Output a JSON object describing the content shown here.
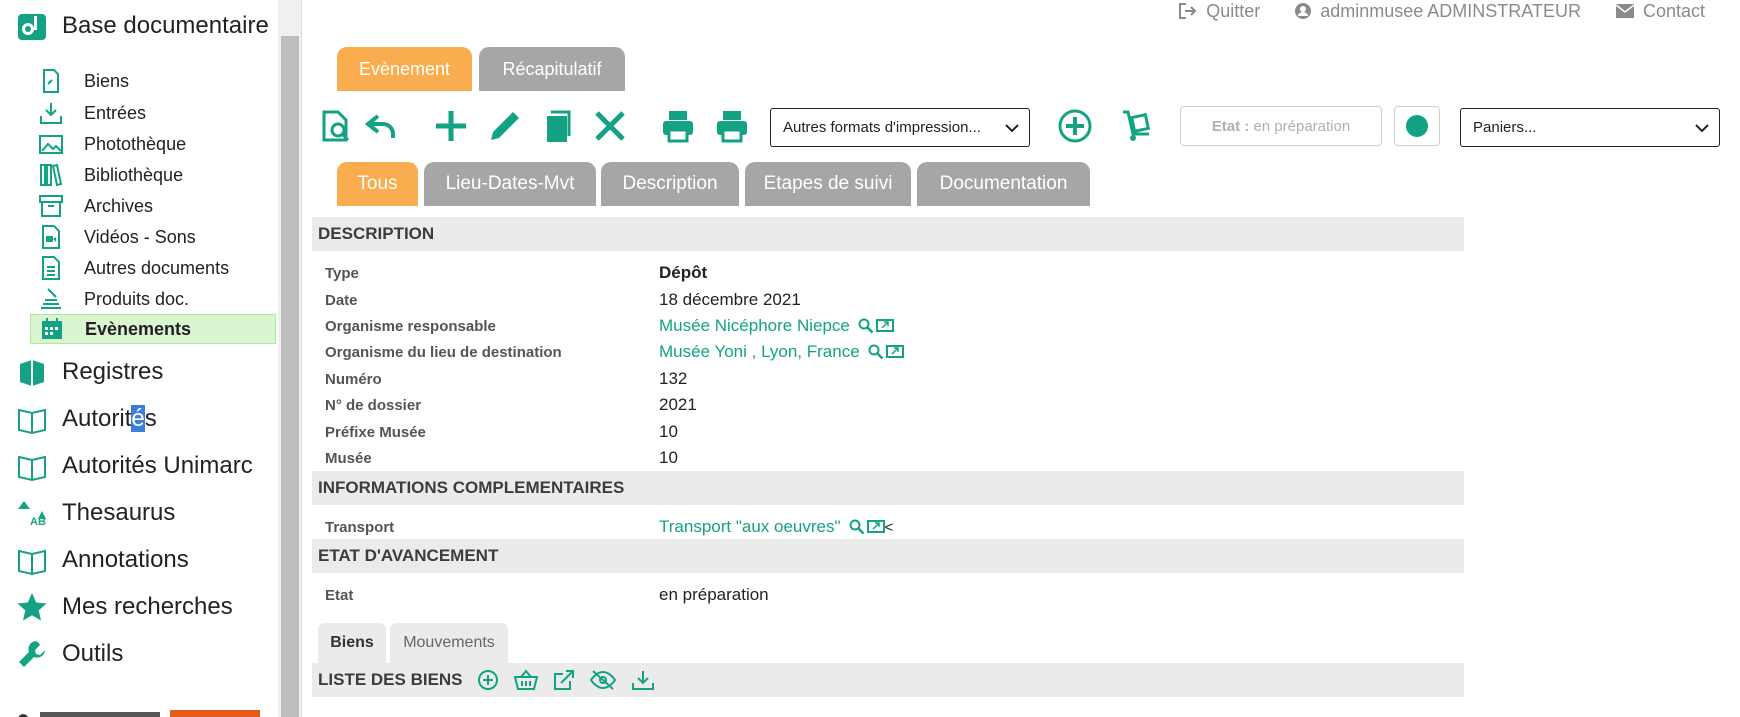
{
  "sidebar": {
    "title": "Base documentaire",
    "sub_items": [
      {
        "label": "Biens"
      },
      {
        "label": "Entrées"
      },
      {
        "label": "Photothèque"
      },
      {
        "label": "Bibliothèque"
      },
      {
        "label": "Archives"
      },
      {
        "label": "Vidéos - Sons"
      },
      {
        "label": "Autres documents"
      },
      {
        "label": "Produits doc."
      },
      {
        "label": "Evènements"
      }
    ],
    "top_items": [
      {
        "label": "Registres"
      },
      {
        "label_pre": "Autorit",
        "label_hl": "é",
        "label_post": "s"
      },
      {
        "label": "Autorités Unimarc"
      },
      {
        "label": "Thesaurus"
      },
      {
        "label": "Annotations"
      },
      {
        "label": "Mes recherches"
      },
      {
        "label": "Outils"
      }
    ]
  },
  "topbar": {
    "quit": "Quitter",
    "user": "adminmusee ADMINSTRATEUR",
    "contact": "Contact"
  },
  "main_tabs": [
    "Evènement",
    "Récapitulatif"
  ],
  "toolbar": {
    "print_select": "Autres formats d'impression...",
    "etat_label": "Etat :",
    "etat_value": "en préparation",
    "panier_select": "Paniers..."
  },
  "section_tabs": [
    "Tous",
    "Lieu-Dates-Mvt",
    "Description",
    "Etapes de suivi",
    "Documentation"
  ],
  "description": {
    "header": "DESCRIPTION",
    "rows": [
      {
        "label": "Type",
        "value": "Dépôt"
      },
      {
        "label": "Date",
        "value": "18 décembre 2021"
      },
      {
        "label": "Organisme responsable",
        "value": "Musée Nicéphore Niepce"
      },
      {
        "label": "Organisme du lieu de destination",
        "value": "Musée Yoni , Lyon, France"
      },
      {
        "label": "Numéro",
        "value": "132"
      },
      {
        "label": "N° de dossier",
        "value": "2021"
      },
      {
        "label": "Préfixe Musée",
        "value": "10"
      },
      {
        "label": "Musée",
        "value": "10"
      }
    ]
  },
  "infos": {
    "header": "INFORMATIONS COMPLEMENTAIRES",
    "rows": [
      {
        "label": "Transport",
        "value": "Transport \"aux oeuvres\"",
        "suffix": "<"
      }
    ]
  },
  "etat": {
    "header": "ETAT D'AVANCEMENT",
    "rows": [
      {
        "label": "Etat",
        "value": "en préparation"
      }
    ]
  },
  "bottom_tabs": [
    "Biens",
    "Mouvements"
  ],
  "liste": {
    "header": "LISTE DES BIENS"
  },
  "colors": {
    "accent": "#13a384",
    "orange_tab": "#f9ad4f",
    "gray_tab": "#a6a6a6",
    "section_bg": "#ebebeb",
    "active_item_bg": "#d9f5d2"
  }
}
